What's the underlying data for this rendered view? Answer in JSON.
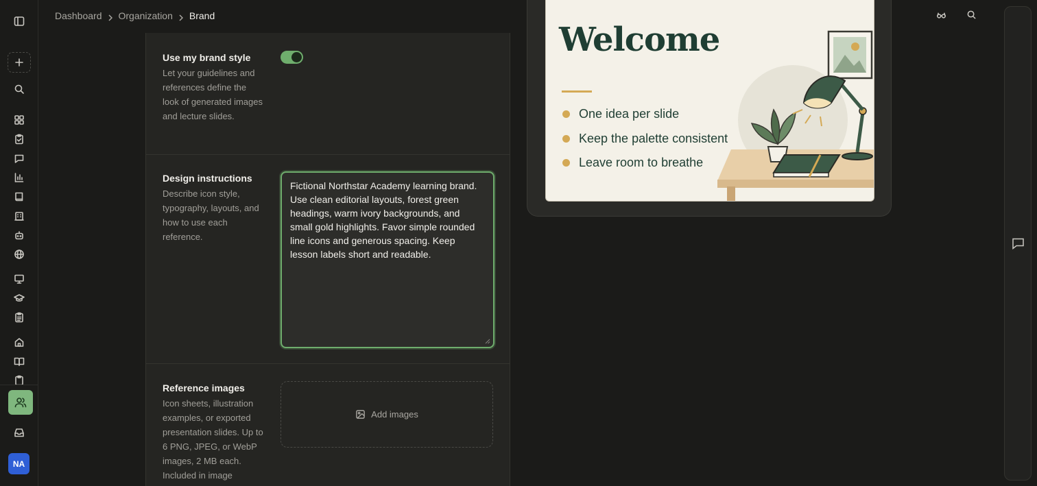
{
  "breadcrumbs": [
    {
      "label": "Dashboard"
    },
    {
      "label": "Organization"
    },
    {
      "label": "Brand"
    }
  ],
  "sidebar": {
    "icons": [
      "panel-toggle-icon",
      "plus-icon",
      "search-icon",
      "grid-icon",
      "clipboard-check-icon",
      "message-icon",
      "bar-chart-icon",
      "book-icon",
      "building-icon",
      "bot-icon",
      "globe-icon",
      "presentation-icon",
      "graduation-cap-icon",
      "clipboard-list-icon",
      "home-icon",
      "open-book-icon",
      "clipboard-icon",
      "users-icon",
      "inbox-icon"
    ],
    "avatar_initials": "NA"
  },
  "brand_style": {
    "title": "Use my brand style",
    "description": "Let your guidelines and references define the look of generated images and lecture slides.",
    "enabled": true
  },
  "design_instructions": {
    "title": "Design instructions",
    "description": "Describe icon style, typography, layouts, and how to use each reference.",
    "value": "Fictional Northstar Academy learning brand. Use clean editorial layouts, forest green headings, warm ivory backgrounds, and small gold highlights. Favor simple rounded line icons and generous spacing. Keep lesson labels short and readable."
  },
  "reference_images": {
    "title": "Reference images",
    "description": "Icon sheets, illustration examples, or exported presentation slides. Up to 6 PNG, JPEG, or WebP images, 2 MB each. Included in image",
    "add_label": "Add images"
  },
  "preview_slide": {
    "heading": "Welcome",
    "bullets": [
      "One idea per slide",
      "Keep the palette consistent",
      "Leave room to breathe"
    ],
    "colors": {
      "heading": "#1f3e33",
      "accent": "#d4a955",
      "background": "#f4f1e8"
    }
  },
  "colors": {
    "accent": "#6fae6d",
    "avatar": "#2f5fd6",
    "active_nav": "#7fb77e"
  }
}
